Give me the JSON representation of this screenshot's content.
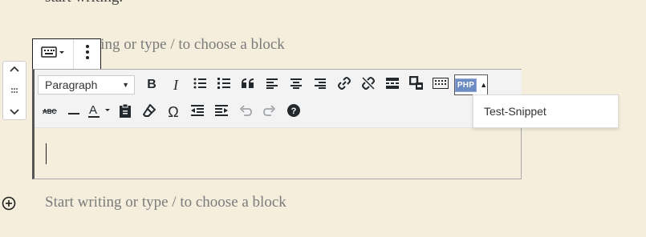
{
  "content": {
    "top_text": "start writing.",
    "block_placeholder": "Start writing or type / to choose a block",
    "block_placeholder_partial": "ting or type / to choose a block"
  },
  "block_toolbar": {
    "switch_icon": "keyboard-icon",
    "more_icon": "vertical-ellipsis-icon"
  },
  "mover": {
    "up_icon": "chevron-up-icon",
    "drag_icon": "drag-handle-icon",
    "down_icon": "chevron-down-icon"
  },
  "toolbar": {
    "format_select": "Paragraph",
    "php_label": "PHP"
  },
  "snippet_menu": {
    "items": [
      "Test-Snippet"
    ]
  },
  "colors": {
    "page_background": "#f5eedd",
    "toolbar_background": "#f3f3f3",
    "php_badge": "#6d8cc4"
  }
}
